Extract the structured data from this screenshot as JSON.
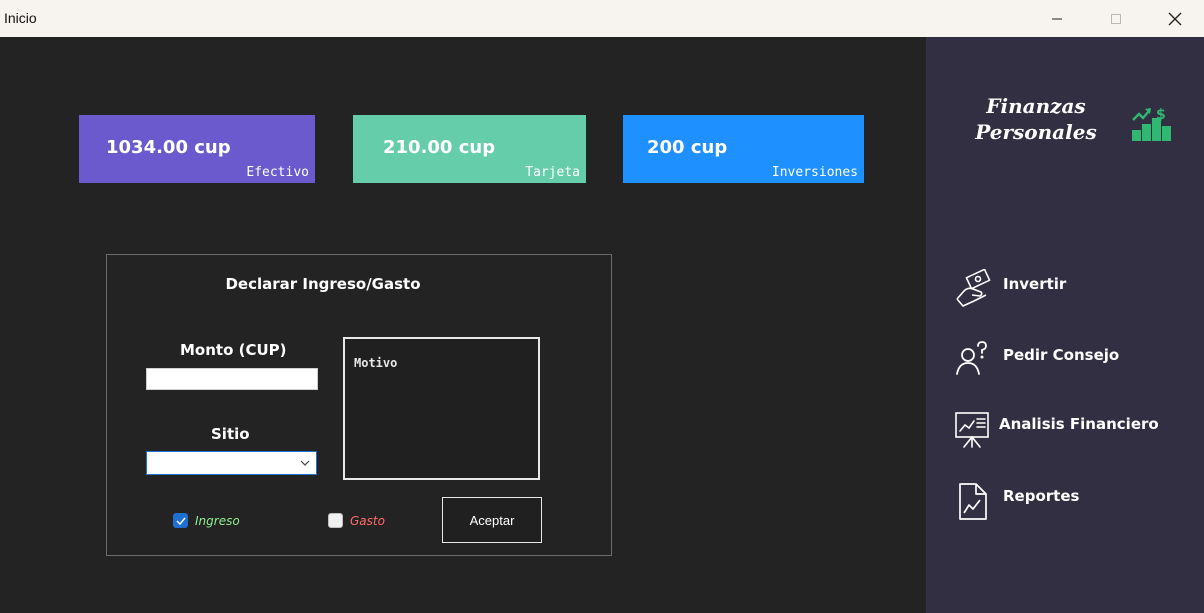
{
  "window": {
    "title": "Inicio",
    "minimize_icon": "minimize-icon",
    "maximize_icon": "maximize-icon",
    "close_icon": "close-icon"
  },
  "balances": [
    {
      "amount": "1034.00 cup",
      "label": "Efectivo",
      "color": "#6a5acd"
    },
    {
      "amount": "210.00 cup",
      "label": "Tarjeta",
      "color": "#66cdaa"
    },
    {
      "amount": "200 cup",
      "label": "Inversiones",
      "color": "#1e90ff"
    }
  ],
  "form": {
    "title": "Declarar Ingreso/Gasto",
    "monto_label": "Monto (CUP)",
    "monto_value": "",
    "sitio_label": "Sitio",
    "sitio_value": "",
    "motivo_text": "Motivo",
    "ingreso_label": "Ingreso",
    "ingreso_checked": true,
    "ingreso_color": "#90ee90",
    "gasto_label": "Gasto",
    "gasto_checked": false,
    "gasto_color": "#ff6b6b",
    "accept_label": "Aceptar"
  },
  "sidebar": {
    "brand": "Finanzas Personales",
    "brand_icon": "growth-chart-icon",
    "items": [
      {
        "label": "Invertir",
        "icon": "money-hand-icon"
      },
      {
        "label": "Pedir Consejo",
        "icon": "person-question-icon"
      },
      {
        "label": "Analisis Financiero",
        "icon": "presentation-board-icon"
      },
      {
        "label": "Reportes",
        "icon": "report-document-icon"
      }
    ]
  },
  "colors": {
    "main_bg": "#232323",
    "sidebar_bg": "#312f41",
    "accent_green": "#2eb872"
  }
}
